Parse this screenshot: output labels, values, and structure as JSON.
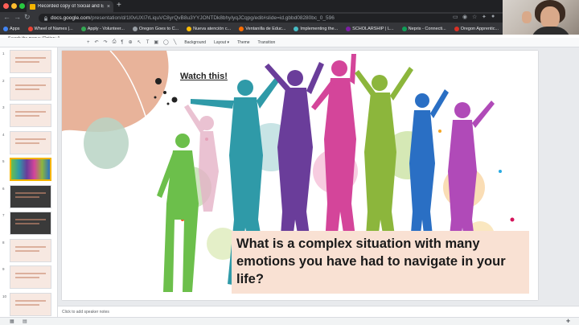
{
  "browser": {
    "tab_title": "Recorded copy of Social and E",
    "tab_close": "×",
    "new_tab": "+",
    "url_host": "docs.google.com",
    "url_path": "/presentation/d/1I0vUXI7rLiquVC8yrQvB8u3YYJONTDk8bhyIyqJCqpg/edit#slide=id.gbbd08280bc_0_596",
    "back_icon": "←",
    "forward_icon": "→",
    "reload_icon": "↻",
    "bookmarks": [
      {
        "label": "Apps",
        "color": "#4285f4"
      },
      {
        "label": "Wheel of Names |...",
        "color": "#ea4335"
      },
      {
        "label": "Apply - Volunteer...",
        "color": "#34a853"
      },
      {
        "label": "Oregon Goes to C...",
        "color": "#9aa0a6"
      },
      {
        "label": "Nueva atención c...",
        "color": "#fbbc04"
      },
      {
        "label": "Ventanilla de Educ...",
        "color": "#ff6d01"
      },
      {
        "label": "Implementing the...",
        "color": "#46bdc6"
      },
      {
        "label": "SCHOLARSHIP | L...",
        "color": "#7b1fa2"
      },
      {
        "label": "Nepris - Connecti...",
        "color": "#0f9d58"
      },
      {
        "label": "Oregon Apprentic...",
        "color": "#d93025"
      }
    ]
  },
  "docs": {
    "search_menus": "Search the menus (Option+/)",
    "toolbar": {
      "add": "+",
      "undo": "↶",
      "redo": "↷",
      "print": "⎙",
      "paint": "¶",
      "zoom": "⊕",
      "select": "↖",
      "textbox": "T",
      "image": "▣",
      "shape": "◯",
      "line": "╲",
      "background": "Background",
      "layout": "Layout ▾",
      "theme": "Theme",
      "transition": "Transition"
    },
    "slide_numbers": [
      "1",
      "2",
      "3",
      "4",
      "5",
      "6",
      "7",
      "8",
      "9",
      "10"
    ],
    "selected_slide": 5,
    "slide": {
      "watch_label": "Watch this!",
      "question": "What is a complex situation with many emotions you have had to navigate in your life?"
    },
    "speaker_notes_placeholder": "Click to add speaker notes"
  },
  "colors": {
    "accent_peach": "#e8b39a",
    "accent_sage": "#b8d4c4",
    "question_bg": "#f9e1d3",
    "selected_border": "#f4b400"
  }
}
